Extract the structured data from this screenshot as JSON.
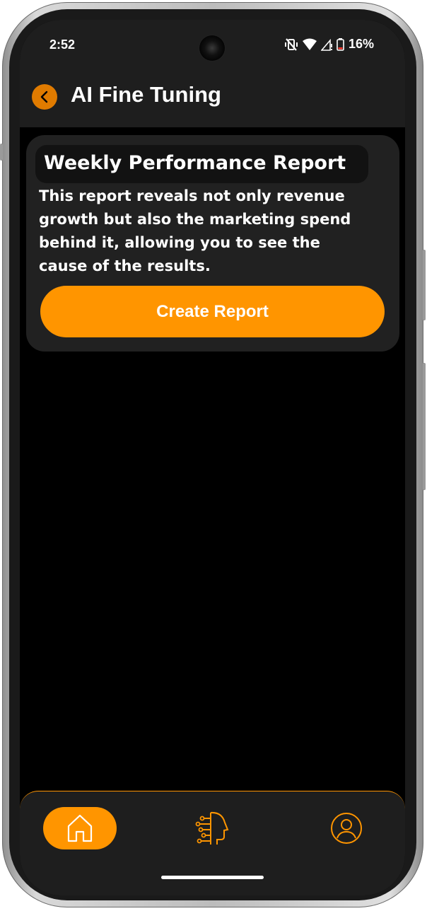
{
  "status_bar": {
    "time": "2:52",
    "battery": "16%",
    "icons": [
      "vibrate-off-icon",
      "wifi-icon",
      "signal-icon",
      "battery-icon"
    ]
  },
  "app_bar": {
    "back_icon": "chevron-left-icon",
    "title": "AI Fine Tuning"
  },
  "card": {
    "title": "Weekly Performance Report",
    "description": "This report reveals not only revenue growth but also the marketing spend behind it, allowing you to see the cause of the results.",
    "button_label": "Create Report"
  },
  "bottom_nav": {
    "items": [
      {
        "icon": "home-icon",
        "active": true
      },
      {
        "icon": "ai-head-icon",
        "active": false
      },
      {
        "icon": "profile-icon",
        "active": false
      }
    ]
  },
  "colors": {
    "accent": "#ff9500",
    "back_button": "#e07b00",
    "background": "#000000",
    "surface": "#212121"
  }
}
